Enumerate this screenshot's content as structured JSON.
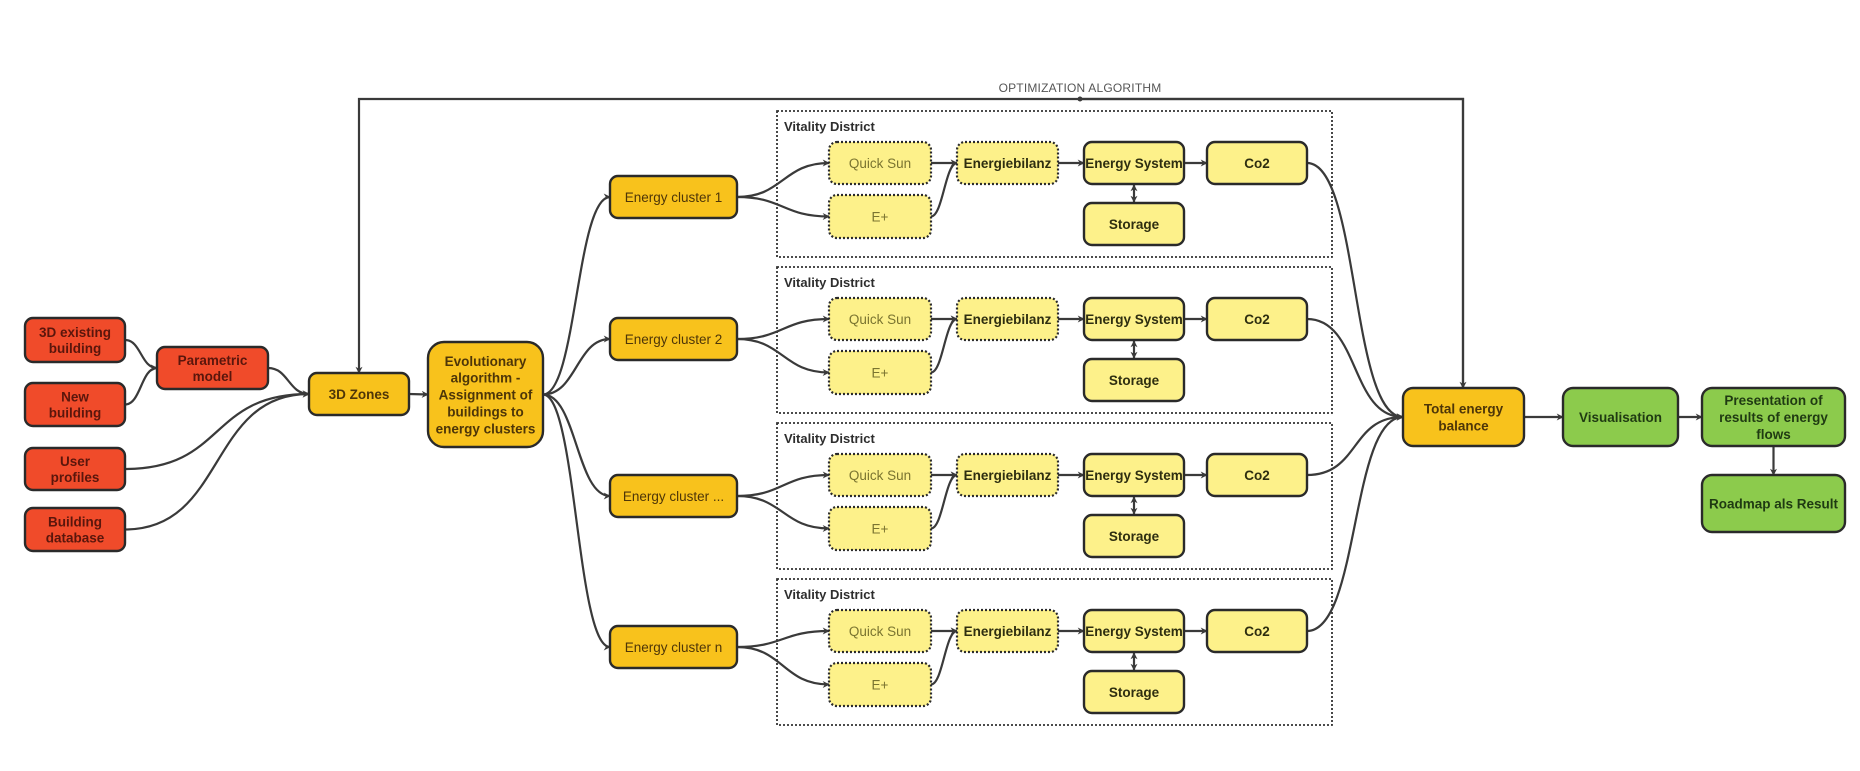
{
  "colors": {
    "input_fill": "#F04B2A",
    "input_text": "#5A160C",
    "process_fill": "#F8C21C",
    "process_text": "#4E3608",
    "module_fill": "#FDF18A",
    "module_text": "#2E2E10",
    "module_light_text": "#7A7430",
    "output_fill": "#8CCB4C",
    "output_text": "#1F3A12"
  },
  "loop": {
    "label": "OPTIMIZATION ALGORITHM"
  },
  "inputs": [
    {
      "id": "existing",
      "label": "3D existing building"
    },
    {
      "id": "new",
      "label": "New building"
    },
    {
      "id": "profiles",
      "label": "User profiles"
    },
    {
      "id": "database",
      "label": "Building database"
    }
  ],
  "parametric": {
    "label": "Parametric model"
  },
  "zones": {
    "label": "3D Zones"
  },
  "evolutionary": {
    "label": "Evolutionary algorithm - Assignment of buildings to energy clusters"
  },
  "clusters": [
    {
      "label": "Energy cluster 1"
    },
    {
      "label": "Energy cluster 2"
    },
    {
      "label": "Energy cluster ..."
    },
    {
      "label": "Energy cluster n"
    }
  ],
  "district": {
    "title": "Vitality District",
    "quick_sun": "Quick Sun",
    "eplus": "E+",
    "energiebilanz": "Energiebilanz",
    "energy_system": "Energy System",
    "storage": "Storage",
    "co2": "Co2"
  },
  "total": {
    "label": "Total energy balance"
  },
  "outputs": [
    {
      "id": "visualisation",
      "label": "Visualisation"
    },
    {
      "id": "presentation",
      "label": "Presentation of results of energy flows"
    },
    {
      "id": "roadmap",
      "label": "Roadmap als Result"
    }
  ]
}
